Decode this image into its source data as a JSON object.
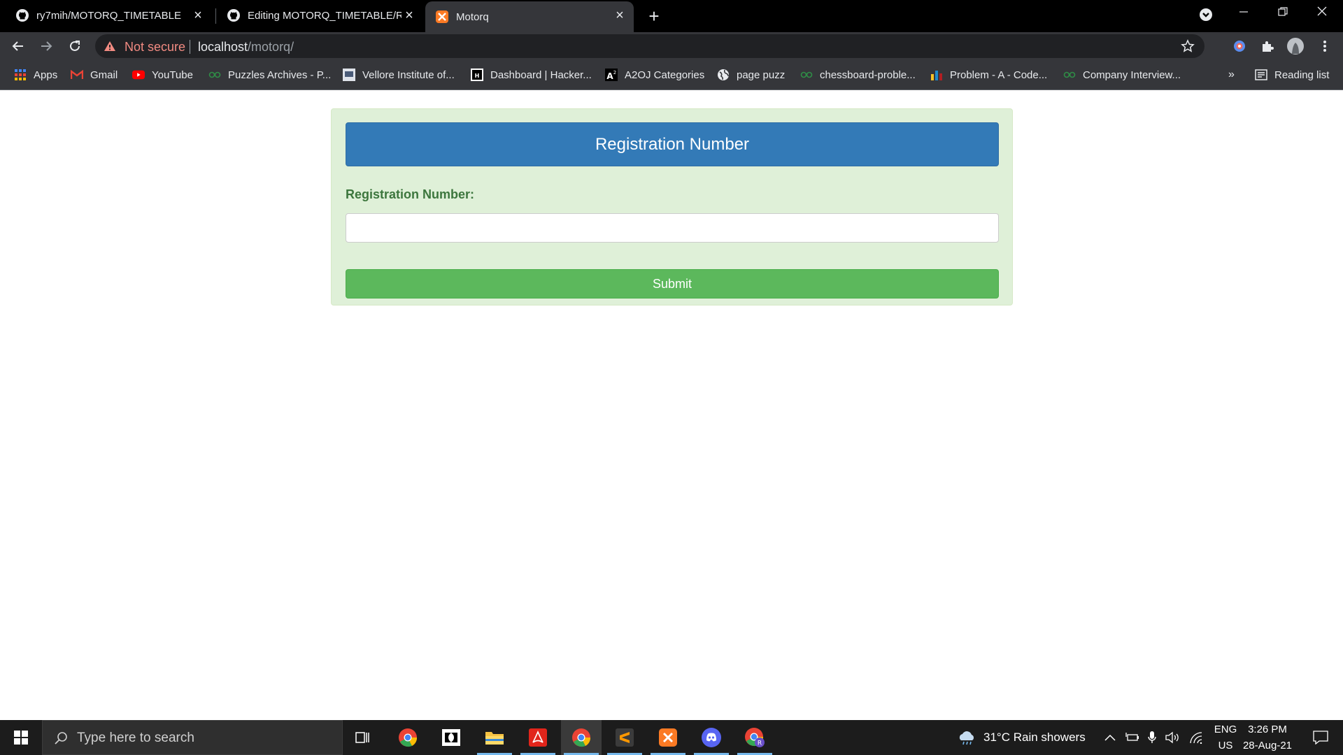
{
  "browser": {
    "tabs": [
      {
        "title": "ry7mih/MOTORQ_TIMETABLE",
        "icon": "github-icon",
        "active": false
      },
      {
        "title": "Editing MOTORQ_TIMETABLE/READ",
        "icon": "github-icon",
        "active": false
      },
      {
        "title": "Motorq",
        "icon": "xampp-icon",
        "active": true
      }
    ],
    "address": {
      "security_label": "Not secure",
      "host": "localhost",
      "path": "/motorq/"
    },
    "bookmarks": [
      {
        "label": "Apps",
        "icon": "apps-grid-icon"
      },
      {
        "label": "Gmail",
        "icon": "gmail-icon"
      },
      {
        "label": "YouTube",
        "icon": "youtube-icon"
      },
      {
        "label": "Puzzles Archives - P...",
        "icon": "geeksforgeeks-icon"
      },
      {
        "label": "Vellore Institute of...",
        "icon": "vit-icon"
      },
      {
        "label": "Dashboard | Hacker...",
        "icon": "hackerrank-icon"
      },
      {
        "label": "A2OJ Categories",
        "icon": "a2oj-icon"
      },
      {
        "label": "page puzz",
        "icon": "globe-icon"
      },
      {
        "label": "chessboard-proble...",
        "icon": "geeksforgeeks-icon"
      },
      {
        "label": "Problem - A - Code...",
        "icon": "codeforces-icon"
      },
      {
        "label": "Company Interview...",
        "icon": "geeksforgeeks-icon"
      }
    ],
    "more_bookmarks": "»",
    "reading_list": "Reading list"
  },
  "form": {
    "heading": "Registration Number",
    "label": "Registration Number:",
    "input_value": "",
    "submit_label": "Submit"
  },
  "taskbar": {
    "search_placeholder": "Type here to search",
    "weather": "31°C  Rain showers",
    "lang_top": "ENG",
    "lang_bottom": "US",
    "time": "3:26 PM",
    "date": "28-Aug-21"
  },
  "colors": {
    "panel_bg": "#dff0d8",
    "heading_bg": "#337ab7",
    "label_text": "#3c763d",
    "submit_bg": "#5cb85c"
  }
}
